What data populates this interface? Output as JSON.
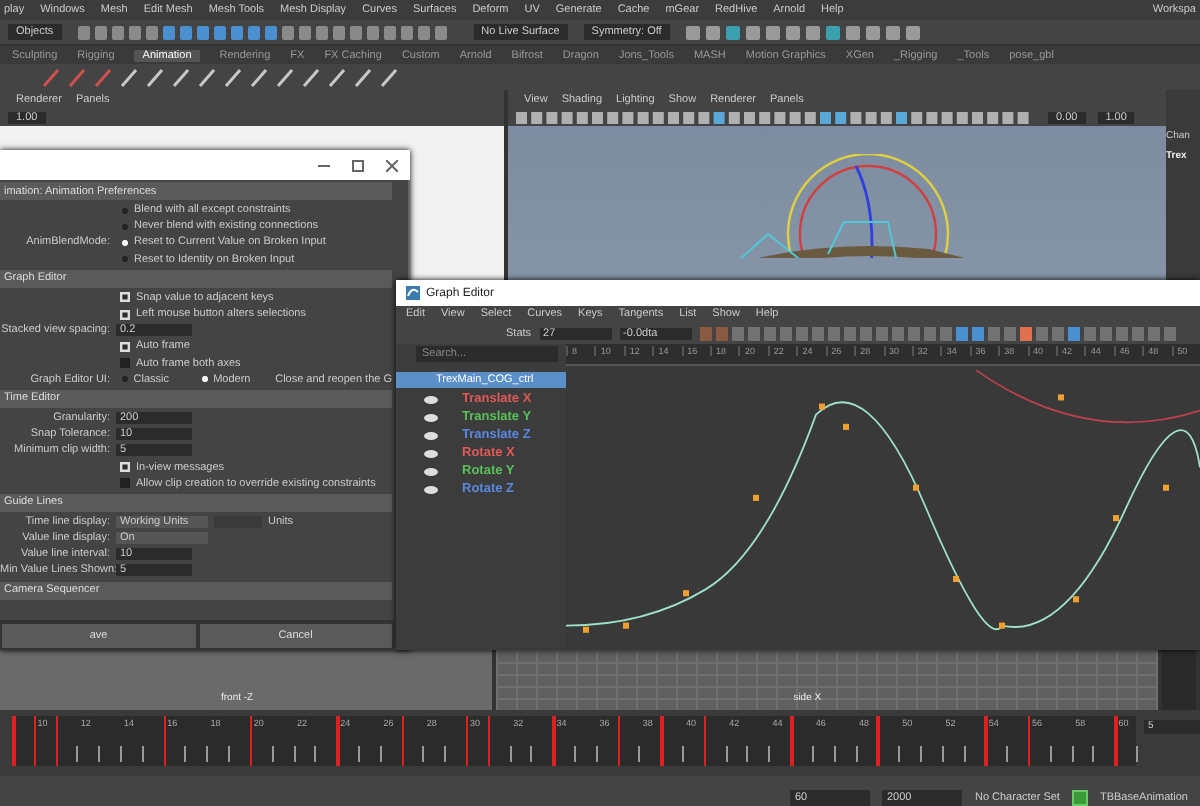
{
  "menu_bar": {
    "items": [
      "play",
      "Windows",
      "Mesh",
      "Edit Mesh",
      "Mesh Tools",
      "Mesh Display",
      "Curves",
      "Surfaces",
      "Deform",
      "UV",
      "Generate",
      "Cache",
      "mGear",
      "RedHive",
      "Arnold",
      "Help"
    ],
    "workspace": "Workspa"
  },
  "status_line": {
    "selection_mode": "Objects",
    "live_surface": "No Live Surface",
    "symmetry": "Symmetry: Off"
  },
  "shelf_tabs": [
    {
      "label": "Sculpting",
      "selected": false
    },
    {
      "label": "Rigging",
      "selected": false
    },
    {
      "label": "Animation",
      "selected": true
    },
    {
      "label": "Rendering",
      "selected": false
    },
    {
      "label": "FX",
      "selected": false
    },
    {
      "label": "FX Caching",
      "selected": false
    },
    {
      "label": "Custom",
      "selected": false
    },
    {
      "label": "Arnold",
      "selected": false
    },
    {
      "label": "Bifrost",
      "selected": false
    },
    {
      "label": "Dragon",
      "selected": false
    },
    {
      "label": "Jons_Tools",
      "selected": false
    },
    {
      "label": "MASH",
      "selected": false
    },
    {
      "label": "Motion Graphics",
      "selected": false
    },
    {
      "label": "XGen",
      "selected": false
    },
    {
      "label": "_Rigging",
      "selected": false
    },
    {
      "label": "_Tools",
      "selected": false
    },
    {
      "label": "pose_gbl",
      "selected": false
    }
  ],
  "left_viewport": {
    "menu": [
      "Renderer",
      "Panels"
    ],
    "fields": [
      "1.00"
    ]
  },
  "main_viewport": {
    "menu": [
      "View",
      "Shading",
      "Lighting",
      "Show",
      "Renderer",
      "Panels"
    ],
    "fields": [
      "0.00",
      "1.00"
    ]
  },
  "channel_box": {
    "tab": "Chan",
    "object": "Trex"
  },
  "bottom_viewports": [
    "front -Z",
    "side X"
  ],
  "preferences": {
    "section_title": "imation: Animation Preferences",
    "sections": [
      {
        "rows": [
          {
            "kind": "radio",
            "label": "",
            "text": "Blend with all except constraints",
            "selected": false
          },
          {
            "kind": "radio",
            "label": "",
            "text": "Never blend with existing connections",
            "selected": false
          },
          {
            "kind": "radio",
            "label": "AnimBlendMode:",
            "text": "Reset to Current Value on Broken Input",
            "selected": true
          },
          {
            "kind": "radio",
            "label": "",
            "text": "Reset to Identity on Broken Input",
            "selected": false
          }
        ]
      },
      {
        "title": "Graph Editor",
        "rows": [
          {
            "kind": "check",
            "label": "",
            "text": "Snap value to adjacent keys",
            "checked": true
          },
          {
            "kind": "check",
            "label": "",
            "text": "Left mouse button alters selections",
            "checked": true
          },
          {
            "kind": "field",
            "label": "Stacked view spacing:",
            "value": "0.2"
          },
          {
            "kind": "check",
            "label": "",
            "text": "Auto frame",
            "checked": true
          },
          {
            "kind": "check",
            "label": "",
            "text": "Auto frame both axes",
            "checked": false
          },
          {
            "kind": "radios",
            "label": "Graph Editor UI:",
            "options": [
              {
                "text": "Classic",
                "selected": false
              },
              {
                "text": "Modern",
                "selected": true
              }
            ],
            "note": "Close and reopen the G"
          }
        ]
      },
      {
        "title": "Time Editor",
        "rows": [
          {
            "kind": "field",
            "label": "Granularity:",
            "value": "200"
          },
          {
            "kind": "field",
            "label": "Snap Tolerance:",
            "value": "10"
          },
          {
            "kind": "field",
            "label": "Minimum clip width:",
            "value": "5"
          },
          {
            "kind": "check",
            "label": "",
            "text": "In-view messages",
            "checked": true
          },
          {
            "kind": "check",
            "label": "",
            "text": "Allow clip creation to override existing constraints",
            "checked": false
          }
        ]
      },
      {
        "title": "Guide Lines",
        "rows": [
          {
            "kind": "dropdown",
            "label": "Time line display:",
            "value": "Working Units",
            "extra": "Units"
          },
          {
            "kind": "dropdown",
            "label": "Value line display:",
            "value": "On"
          },
          {
            "kind": "field",
            "label": "Value line interval:",
            "value": "10"
          },
          {
            "kind": "field",
            "label": "Min Value Lines Shown:",
            "value": "5"
          }
        ]
      },
      {
        "title": "Camera Sequencer"
      }
    ],
    "buttons": [
      "ave",
      "Cancel"
    ]
  },
  "graph_editor": {
    "title": "Graph Editor",
    "menu": [
      "Edit",
      "View",
      "Select",
      "Curves",
      "Keys",
      "Tangents",
      "List",
      "Show",
      "Help"
    ],
    "stats_label": "Stats",
    "stats_fields": [
      "27",
      "-0.0dta"
    ],
    "search": {
      "placeholder": "Search..."
    },
    "outliner": {
      "object": {
        "name": "TrexMain_COG_ctrl",
        "selected": true
      },
      "channels": [
        {
          "name": "Translate X",
          "color": "#e05858"
        },
        {
          "name": "Translate Y",
          "color": "#58c058"
        },
        {
          "name": "Translate Z",
          "color": "#5888e0"
        },
        {
          "name": "Rotate X",
          "color": "#e05858"
        },
        {
          "name": "Rotate Y",
          "color": "#58c058"
        },
        {
          "name": "Rotate Z",
          "color": "#5888e0"
        }
      ]
    },
    "ruler": [
      "8",
      "10",
      "12",
      "14",
      "16",
      "18",
      "20",
      "22",
      "24",
      "26",
      "28",
      "30",
      "32",
      "34",
      "36",
      "38",
      "40",
      "42",
      "44",
      "46",
      "48",
      "50"
    ]
  },
  "timeline": {
    "labels": [
      "10",
      "12",
      "14",
      "16",
      "18",
      "20",
      "22",
      "24",
      "26",
      "28",
      "30",
      "32",
      "34",
      "36",
      "38",
      "40",
      "42",
      "44",
      "46",
      "48",
      "50",
      "52",
      "54",
      "56",
      "58",
      "60"
    ],
    "frames": [
      {
        "keyed": true
      },
      {
        "keyed": true
      },
      {
        "keyed": true
      },
      {
        "keyed": false
      },
      {
        "keyed": false
      },
      {
        "keyed": false
      },
      {
        "keyed": false
      },
      {
        "keyed": true
      },
      {
        "keyed": false
      },
      {
        "keyed": false
      },
      {
        "keyed": false
      },
      {
        "keyed": true
      },
      {
        "keyed": false
      },
      {
        "keyed": false
      },
      {
        "keyed": false
      },
      {
        "keyed": true
      },
      {
        "keyed": false
      },
      {
        "keyed": false
      },
      {
        "keyed": true
      },
      {
        "keyed": false
      },
      {
        "keyed": false
      },
      {
        "keyed": true
      },
      {
        "keyed": true
      },
      {
        "keyed": false
      },
      {
        "keyed": false
      },
      {
        "keyed": true
      },
      {
        "keyed": false
      },
      {
        "keyed": false
      },
      {
        "keyed": true
      },
      {
        "keyed": false
      },
      {
        "keyed": true
      },
      {
        "keyed": false
      },
      {
        "keyed": true
      },
      {
        "keyed": false
      },
      {
        "keyed": false
      },
      {
        "keyed": false
      },
      {
        "keyed": true
      },
      {
        "keyed": false
      },
      {
        "keyed": false
      },
      {
        "keyed": false
      },
      {
        "keyed": true
      },
      {
        "keyed": false
      },
      {
        "keyed": false
      },
      {
        "keyed": false
      },
      {
        "keyed": false
      },
      {
        "keyed": true
      },
      {
        "keyed": false
      },
      {
        "keyed": true
      },
      {
        "keyed": false
      },
      {
        "keyed": false
      },
      {
        "keyed": false
      },
      {
        "keyed": true
      },
      {
        "keyed": false
      }
    ],
    "field": "5"
  },
  "range_bar": {
    "end": "60",
    "max": "2000",
    "character_set": "No Character Set",
    "layer": "TBBaseAnimation"
  }
}
